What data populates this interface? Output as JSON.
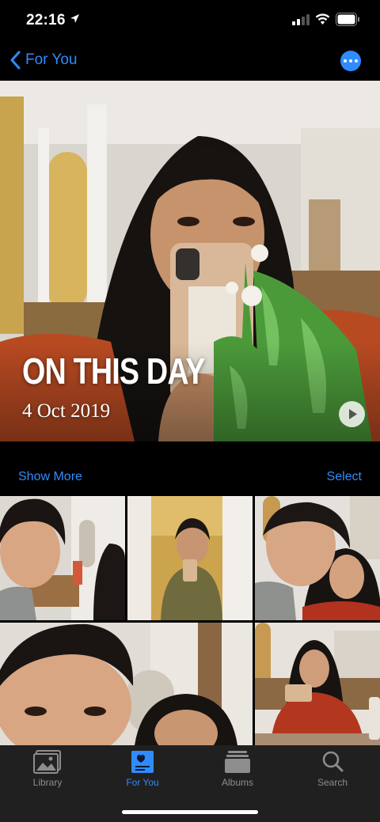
{
  "status_bar": {
    "time": "22:16"
  },
  "nav": {
    "back_label": "For You"
  },
  "memory": {
    "title": "ON THIS DAY",
    "date": "4 Oct 2019"
  },
  "actions": {
    "show_more": "Show More",
    "select": "Select"
  },
  "tabs": [
    {
      "label": "Library",
      "icon": "photo-library-icon"
    },
    {
      "label": "For You",
      "icon": "for-you-icon",
      "active": true
    },
    {
      "label": "Albums",
      "icon": "albums-icon"
    },
    {
      "label": "Search",
      "icon": "search-icon"
    }
  ],
  "colors": {
    "accent": "#2f8cff",
    "tab_inactive": "#8d8d8d",
    "background": "#000000"
  }
}
